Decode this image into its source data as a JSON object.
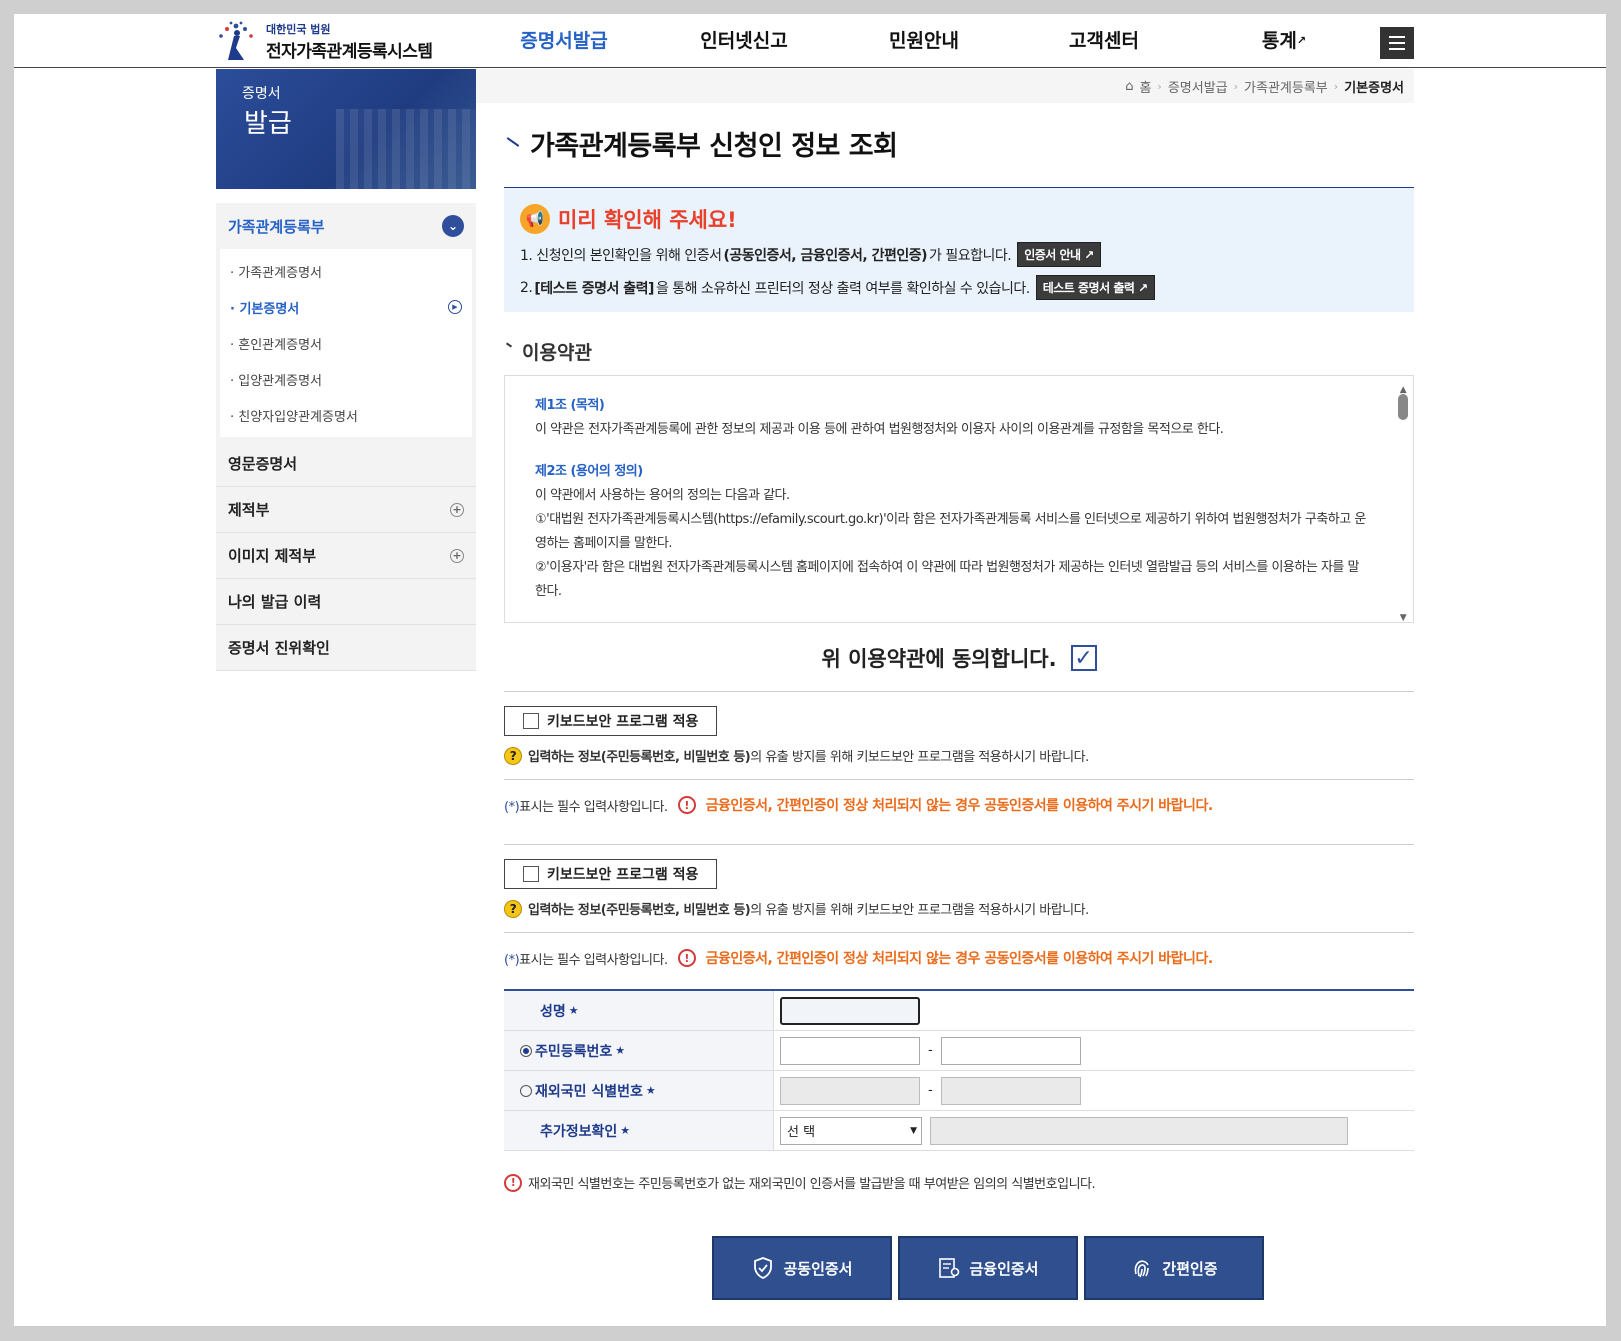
{
  "header": {
    "logo_sub": "대한민국 법원",
    "logo_main": "전자가족관계등록시스템",
    "nav": [
      "증명서발급",
      "인터넷신고",
      "민원안내",
      "고객센터",
      "통계"
    ]
  },
  "sidebar": {
    "banner_line1": "증명서",
    "banner_line2": "발급",
    "open_item": "가족관계등록부",
    "sub_items": [
      "· 가족관계증명서",
      "· 기본증명서",
      "· 혼인관계증명서",
      "· 입양관계증명서",
      "· 친양자입양관계증명서"
    ],
    "items": [
      "영문증명서",
      "제적부",
      "이미지 제적부",
      "나의 발급 이력",
      "증명서 진위확인"
    ]
  },
  "breadcrumb": {
    "home": "홈",
    "b1": "증명서발급",
    "b2": "가족관계등록부",
    "current": "기본증명서"
  },
  "page": {
    "title": "가족관계등록부 신청인 정보 조회"
  },
  "notice": {
    "title": "미리 확인해 주세요!",
    "line1_a": "1. 신청인의 본인확인을 위해 인증서",
    "line1_b": "(공동인증서, 금융인증서, 간편인증)",
    "line1_c": "가 필요합니다.",
    "btn1": "인증서 안내",
    "line2_a": "2.",
    "line2_b": "[테스트 증명서 출력]",
    "line2_c": "을 통해 소유하신 프린터의 정상 출력 여부를 확인하실 수 있습니다.",
    "btn2": "테스트 증명서 출력"
  },
  "terms": {
    "heading": "이용약관",
    "art1_title": "제1조 (목적)",
    "art1_body": "이 약관은 전자가족관계등록에 관한 정보의 제공과 이용 등에 관하여 법원행정처와 이용자 사이의 이용관계를 규정함을 목적으로 한다.",
    "art2_title": "제2조 (용어의 정의)",
    "art2_body": "이 약관에서 사용하는 용어의 정의는 다음과 같다.",
    "art2_item1": "①'대법원 전자가족관계등록시스템(https://efamily.scourt.go.kr)'이라 함은 전자가족관계등록 서비스를 인터넷으로 제공하기 위하여 법원행정처가 구축하고 운영하는 홈페이지를 말한다.",
    "art2_item2": "②'이용자'라 함은 대법원 전자가족관계등록시스템 홈페이지에 접속하여 이 약관에 따라 법원행정처가 제공하는 인터넷 열람발급 등의 서비스를 이용하는 자를 말한다."
  },
  "agree": {
    "label": "위 이용약관에 동의합니다.",
    "checked": true
  },
  "security": {
    "kb_label": "키보드보안 프로그램 적용",
    "hint_a": "입력하는 정보",
    "hint_b": "(주민등록번호, 비밀번호 등)",
    "hint_c": "의 유출 방지를 위해 키보드보안 프로그램을 적용하시기 바랍니다.",
    "req_note": "표시는 필수 입력사항입니다.",
    "req_mark": "(*)",
    "warning": "금융인증서, 간편인증이 정상 처리되지 않는 경우 공동인증서를 이용하여 주시기 바랍니다."
  },
  "form": {
    "name_label": "성명",
    "rrn_label": "주민등록번호",
    "foreign_label": "재외국민 식별번호",
    "extra_label": "추가정보확인",
    "dash": "-",
    "select_value": "선 택",
    "star": "★"
  },
  "footnote": "재외국민 식별번호는 주민등록번호가 없는 재외국민이 인증서를 발급받을 때 부여받은 임의의 식별번호입니다.",
  "auth": {
    "btn1": "공동인증서",
    "btn2": "금융인증서",
    "btn3": "간편인증"
  },
  "colors": {
    "primary": "#2f4e9c",
    "active_text": "#2561c6",
    "warning": "#ea6b1b",
    "notice_title": "#e8402a"
  }
}
